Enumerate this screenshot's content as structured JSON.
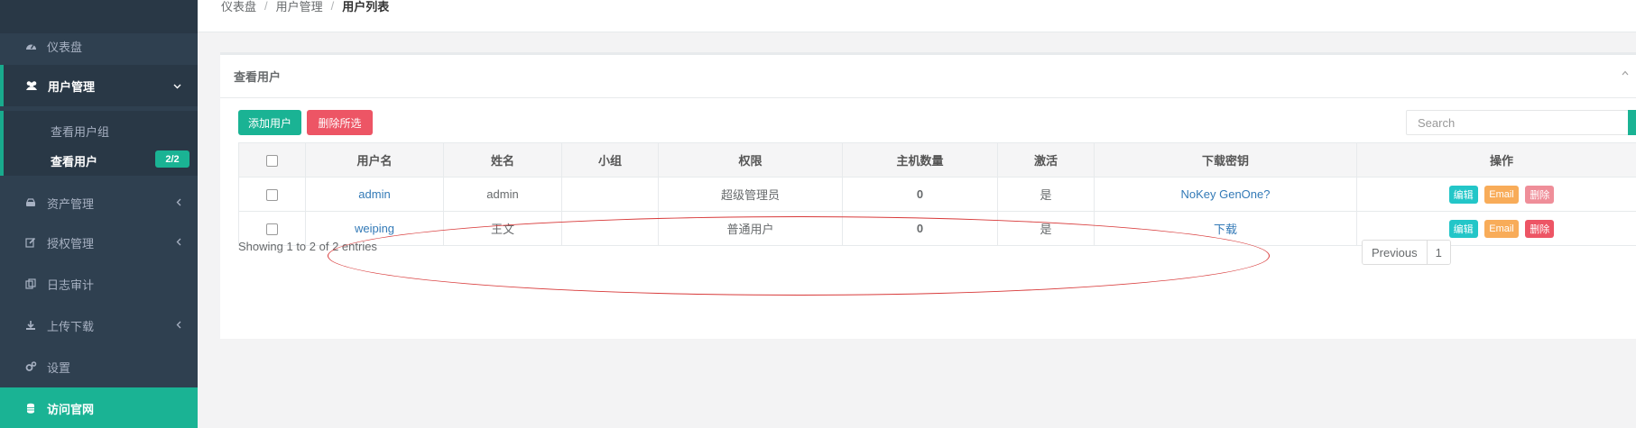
{
  "breadcrumb": {
    "items": [
      "仪表盘",
      "用户管理"
    ],
    "current": "用户列表",
    "separator": "/"
  },
  "sidebar": {
    "items": [
      {
        "label": "仪表盘",
        "icon": "dashboard-icon"
      },
      {
        "label": "用户管理",
        "icon": "users-icon",
        "arrow": "chevron-down-icon"
      },
      {
        "label": "资产管理",
        "icon": "hdd-icon",
        "arrow": "chevron-left-icon"
      },
      {
        "label": "授权管理",
        "icon": "edit-icon",
        "arrow": "chevron-left-icon"
      },
      {
        "label": "日志审计",
        "icon": "copy-icon"
      },
      {
        "label": "上传下载",
        "icon": "download-icon",
        "arrow": "chevron-left-icon"
      },
      {
        "label": "设置",
        "icon": "gears-icon"
      },
      {
        "label": "访问官网",
        "icon": "database-icon"
      }
    ],
    "submenu": [
      {
        "label": "查看用户组"
      },
      {
        "label": "查看用户",
        "badge": "2/2"
      }
    ]
  },
  "panel": {
    "title": "查看用户",
    "add_button": "添加用户",
    "delete_selected_button": "删除所选",
    "search_placeholder": "Search"
  },
  "table": {
    "columns": [
      "用户名",
      "姓名",
      "小组",
      "权限",
      "主机数量",
      "激活",
      "下载密钥",
      "操作"
    ],
    "rows": [
      {
        "username": "admin",
        "name": "admin",
        "group": "",
        "role": "超级管理员",
        "hosts": "0",
        "active": "是",
        "key": "NoKey GenOne?",
        "delete_disabled": true
      },
      {
        "username": "weiping",
        "name": "王文",
        "group": "",
        "role": "普通用户",
        "hosts": "0",
        "active": "是",
        "key": "下载",
        "delete_disabled": false
      }
    ],
    "actions": {
      "edit": "编辑",
      "email": "Email",
      "delete": "删除"
    }
  },
  "footer": {
    "showing": "Showing 1 to 2 of 2 entries",
    "pagination": {
      "previous": "Previous",
      "page": "1"
    }
  },
  "colors": {
    "sidebar_bg": "#2f4050",
    "accent": "#1ab394",
    "danger": "#ed5565",
    "info": "#23c6c8",
    "warning": "#f8ac59",
    "annotation": "#d83a3a"
  }
}
